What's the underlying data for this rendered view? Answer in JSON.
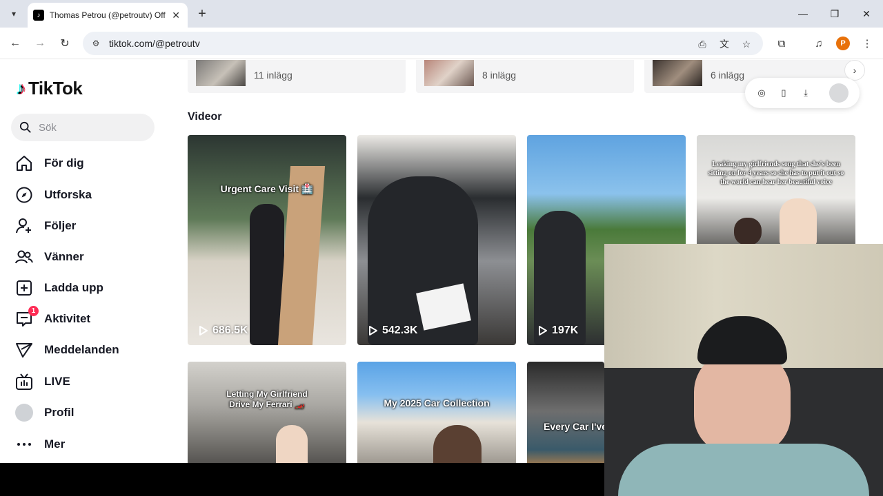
{
  "browser": {
    "tab_title": "Thomas Petrou (@petroutv) Offi",
    "tab_favicon": "tiktok-logo-icon",
    "url": "tiktok.com/@petroutv",
    "profile_initial": "P"
  },
  "app": {
    "brand": "TikTok",
    "search_placeholder": "Sök"
  },
  "sidebar": {
    "items": [
      {
        "label": "För dig",
        "icon": "home-icon"
      },
      {
        "label": "Utforska",
        "icon": "compass-icon"
      },
      {
        "label": "Följer",
        "icon": "person-add-icon"
      },
      {
        "label": "Vänner",
        "icon": "friends-icon"
      },
      {
        "label": "Ladda upp",
        "icon": "upload-icon"
      },
      {
        "label": "Aktivitet",
        "icon": "inbox-icon",
        "badge": "1"
      },
      {
        "label": "Meddelanden",
        "icon": "send-icon"
      },
      {
        "label": "LIVE",
        "icon": "live-tv-icon"
      },
      {
        "label": "Profil",
        "icon": "avatar"
      },
      {
        "label": "Mer",
        "icon": "more-dots-icon"
      }
    ]
  },
  "collections": [
    {
      "count_text": "11 inlägg"
    },
    {
      "count_text": "8 inlägg"
    },
    {
      "count_text": "6 inlägg"
    }
  ],
  "videos_section_title": "Videor",
  "videos": [
    {
      "caption": "Urgent Care Visit 🏥",
      "views": "686.5K"
    },
    {
      "caption": "",
      "views": "542.3K"
    },
    {
      "caption": "",
      "views": "197K"
    },
    {
      "caption": "Leaking my girlfriends song that she's been sitting on for 4 years so she has to put it out so the world can hear her beautiful voice",
      "views": ""
    },
    {
      "caption": "Letting My Girlfriend Drive My Ferrari 🏎️",
      "views": ""
    },
    {
      "caption": "My 2025 Car Collection",
      "views": ""
    },
    {
      "caption": "Every Car I've",
      "views": ""
    }
  ],
  "colors": {
    "brand_red": "#fe2c55",
    "brand_cyan": "#25f4ee",
    "profile_orange": "#e8710a"
  }
}
